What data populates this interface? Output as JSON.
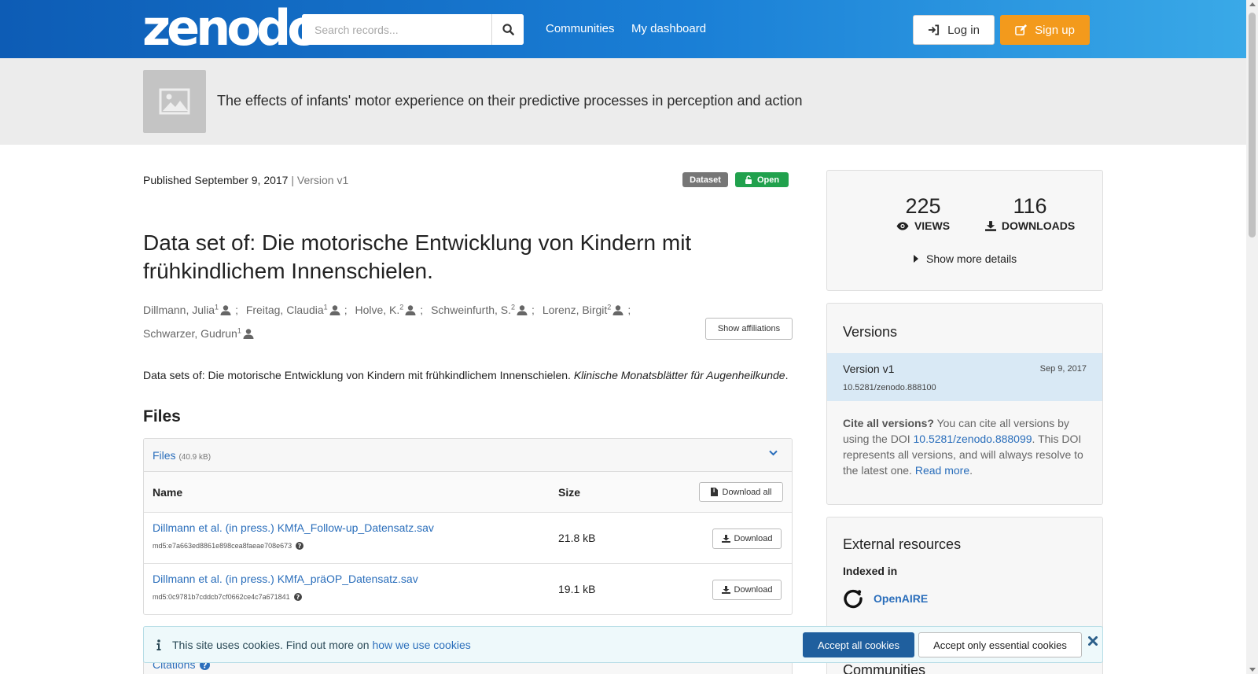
{
  "header": {
    "logo": "zenodo",
    "search_placeholder": "Search records...",
    "nav": [
      "Communities",
      "My dashboard"
    ],
    "login_label": "Log in",
    "signup_label": "Sign up"
  },
  "community": {
    "title": "The effects of infants' motor experience on their predictive processes in perception and action"
  },
  "record": {
    "published_prefix": "Published",
    "published_date": "September 9, 2017",
    "version_text": "| Version v1",
    "badge_type": "Dataset",
    "badge_access": "Open",
    "title": "Data set of: Die motorische Entwicklung von Kindern mit frühkindlichem Innenschielen.",
    "authors": [
      {
        "name": "Dillmann, Julia",
        "aff": "1"
      },
      {
        "name": "Freitag, Claudia",
        "aff": "1"
      },
      {
        "name": "Holve, K.",
        "aff": "2"
      },
      {
        "name": "Schweinfurth, S.",
        "aff": "2"
      },
      {
        "name": "Lorenz, Birgit",
        "aff": "2"
      },
      {
        "name": "Schwarzer, Gudrun",
        "aff": "1"
      }
    ],
    "author_separator": ";",
    "show_affiliations_label": "Show affiliations",
    "description_plain": "Data sets of: Die motorische Entwicklung von Kindern mit frühkindlichem Innenschielen. ",
    "description_italic": "Klinische Monatsblätter für Augenheilkunde",
    "description_end": "."
  },
  "files": {
    "heading": "Files",
    "panel_label": "Files",
    "panel_size": "(40.9 kB)",
    "col_name": "Name",
    "col_size": "Size",
    "download_all_label": "Download all",
    "download_label": "Download",
    "rows": [
      {
        "name": "Dillmann et al. (in press.) KMfA_Follow-up_Datensatz.sav",
        "md5": "md5:e7a663ed8861e898cea8faeae708e673",
        "size": "21.8 kB"
      },
      {
        "name": "Dillmann et al. (in press.) KMfA_präOP_Datensatz.sav",
        "md5": "md5:0c9781b7cddcb7cf0662ce4c7a671841",
        "size": "19.1 kB"
      }
    ],
    "citations_label": "Citations"
  },
  "stats": {
    "views": "225",
    "views_label": "VIEWS",
    "downloads": "116",
    "downloads_label": "DOWNLOADS",
    "more_label": "Show more details"
  },
  "versions": {
    "heading": "Versions",
    "current_name": "Version v1",
    "current_date": "Sep 9, 2017",
    "current_doi": "10.5281/zenodo.888100",
    "cite_bold": "Cite all versions?",
    "cite_text_1": " You can cite all versions by using the DOI ",
    "cite_doi": "10.5281/zenodo.888099",
    "cite_text_2": ". This DOI represents all versions, and will always resolve to the latest one. ",
    "read_more": "Read more",
    "cite_end": "."
  },
  "external": {
    "heading": "External resources",
    "indexed_in": "Indexed in",
    "openaire": "OpenAIRE",
    "communities_heading": "Communities"
  },
  "cookie": {
    "text": "This site uses cookies. Find out more on ",
    "link": "how we use cookies",
    "accept_all": "Accept all cookies",
    "accept_essential": "Accept only essential cookies"
  },
  "colors": {
    "header_start": "#0d5cb5",
    "header_end": "#3aaae8",
    "signup": "#f39a1c",
    "open_badge": "#21a14d",
    "link": "#2a6ebb",
    "accept": "#1f5f9e"
  }
}
